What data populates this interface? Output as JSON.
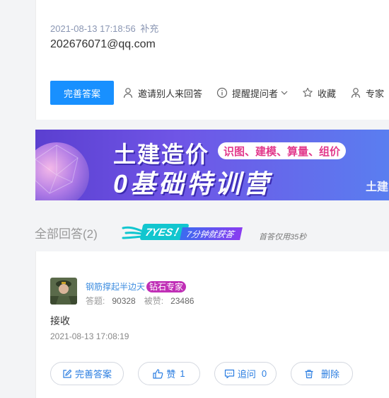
{
  "question": {
    "timestamp": "2021-08-13 17:18:56",
    "supplement_label": "补充",
    "content": "202676071@qq.com"
  },
  "question_actions": {
    "improve_answer": "完善答案",
    "invite": "邀请别人来回答",
    "remind": "提醒提问者",
    "favorite": "收藏",
    "expert": "专家"
  },
  "banner": {
    "line1": "土建造价",
    "tagline": "识图、建模、算量、组价",
    "line2": "0基础特训营",
    "corner": "土建"
  },
  "answers": {
    "title": "全部回答(2)",
    "badge_main": "7YES！",
    "badge_tail": "7分钟就获答",
    "first_answer_note": "首答仅用35秒"
  },
  "answer": {
    "username": "钢筋撑起半边天",
    "rank": "钻石专家",
    "questions_label": "答题:",
    "questions_count": "90328",
    "likes_label": "被赞:",
    "likes_count": "23486",
    "text": "接收",
    "timestamp": "2021-08-13 17:08:19",
    "actions": {
      "improve": "完善答案",
      "like": "赞",
      "like_count": "1",
      "followup": "追问",
      "followup_count": "0",
      "delete": "删除"
    }
  },
  "colors": {
    "primary": "#1890ff",
    "link": "#2a7de1",
    "rank_badge": "#c02fb6"
  }
}
